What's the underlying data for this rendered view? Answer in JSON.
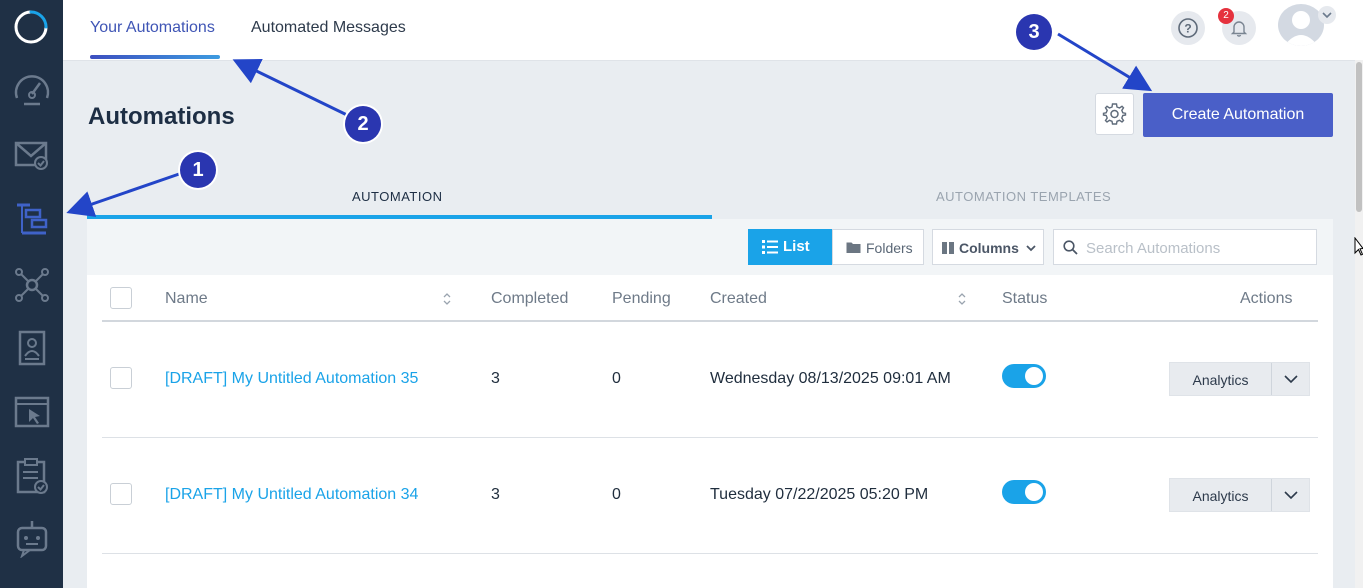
{
  "sidebar": {
    "items": [
      {
        "icon": "dashboard-gauge-icon"
      },
      {
        "icon": "email-icon"
      },
      {
        "icon": "automation-flow-icon",
        "active": true
      },
      {
        "icon": "network-icon"
      },
      {
        "icon": "contact-card-icon"
      },
      {
        "icon": "landing-page-icon"
      },
      {
        "icon": "checklist-icon"
      },
      {
        "icon": "bot-icon"
      }
    ]
  },
  "top_nav": {
    "tabs": [
      {
        "label": "Your Automations",
        "active": true
      },
      {
        "label": "Automated Messages",
        "active": false
      }
    ],
    "notification_count": "2"
  },
  "page": {
    "title": "Automations",
    "create_button": "Create Automation"
  },
  "sub_tabs": [
    {
      "label": "AUTOMATION",
      "active": true
    },
    {
      "label": "AUTOMATION TEMPLATES",
      "active": false
    }
  ],
  "toolbar": {
    "list": "List",
    "folders": "Folders",
    "columns": "Columns",
    "search_placeholder": "Search Automations"
  },
  "table": {
    "headers": {
      "name": "Name",
      "completed": "Completed",
      "pending": "Pending",
      "created": "Created",
      "status": "Status",
      "actions": "Actions"
    },
    "rows": [
      {
        "name": "[DRAFT] My Untitled Automation 35",
        "completed": "3",
        "pending": "0",
        "created": "Wednesday 08/13/2025 09:01 AM",
        "status_on": true,
        "action": "Analytics"
      },
      {
        "name": "[DRAFT] My Untitled Automation 34",
        "completed": "3",
        "pending": "0",
        "created": "Tuesday 07/22/2025 05:20 PM",
        "status_on": true,
        "action": "Analytics"
      }
    ]
  },
  "annotations": [
    "1",
    "2",
    "3"
  ],
  "colors": {
    "sidebar_bg": "#1f3045",
    "accent_blue": "#1aa3e8",
    "primary_button": "#4a5fc8",
    "annotation": "#2a36b0"
  }
}
